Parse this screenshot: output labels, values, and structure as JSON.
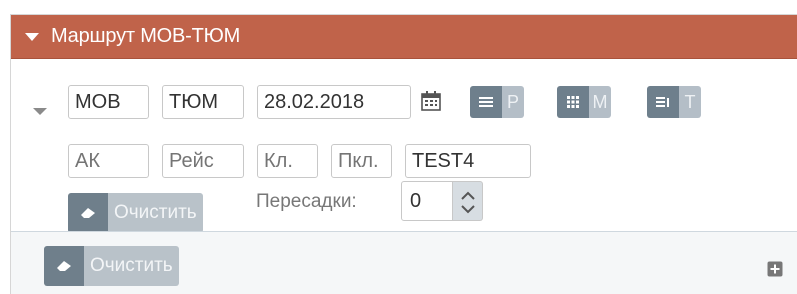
{
  "header": {
    "title": "Маршрут MOB-ТЮМ"
  },
  "row1": {
    "from": "MOB",
    "to": "ТЮМ",
    "date": "28.02.2018",
    "toggles": [
      {
        "letter": "P",
        "icon": "list-icon"
      },
      {
        "letter": "M",
        "icon": "grid-icon"
      },
      {
        "letter": "T",
        "icon": "fare-list-icon"
      }
    ]
  },
  "row2": {
    "airline_placeholder": "АК",
    "flight_placeholder": "Рейс",
    "class_placeholder": "Кл.",
    "subclass_placeholder": "Пкл.",
    "code_value": "TEST4"
  },
  "row3": {
    "clear_label": "Очистить",
    "transfers_label": "Пересадки:",
    "transfers_value": "0"
  },
  "footer": {
    "clear_label": "Очистить"
  },
  "colors": {
    "header_bg": "#c0634a",
    "button_dark": "#6f7f8b",
    "button_light": "#b9c2c9"
  }
}
